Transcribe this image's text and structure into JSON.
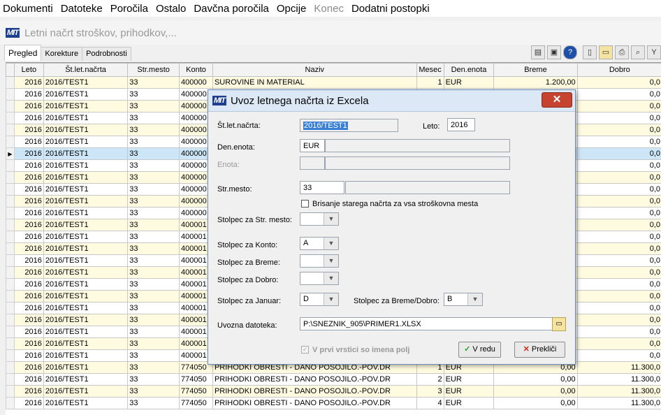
{
  "menu": [
    "Dokumenti",
    "Datoteke",
    "Poročila",
    "Ostalo",
    "Davčna poročila",
    "Opcije",
    "Konec",
    "Dodatni postopki"
  ],
  "app": {
    "logo": "MIT",
    "title": "Letni načrt stroškov, prihodkov,..."
  },
  "tabs": [
    "Pregled",
    "Korekture",
    "Podrobnosti"
  ],
  "toolbar_icons": [
    "book-icon",
    "window-icon",
    "help-icon",
    "new-icon",
    "open-icon",
    "print-icon",
    "search-icon",
    "filter-icon"
  ],
  "grid": {
    "columns": [
      "Leto",
      "Št.let.načrta",
      "Str.mesto",
      "Konto",
      "Naziv",
      "Mesec",
      "Den.enota",
      "Breme",
      "Dobro"
    ],
    "rows": [
      [
        "2016",
        "2016/TEST1",
        "33",
        "400000",
        "SUROVINE IN MATERIAL",
        "1",
        "EUR",
        "1.200,00",
        "0,0"
      ],
      [
        "2016",
        "2016/TEST1",
        "33",
        "400000",
        "",
        "",
        "",
        "",
        "0,0"
      ],
      [
        "2016",
        "2016/TEST1",
        "33",
        "400000",
        "",
        "",
        "",
        "",
        "0,0"
      ],
      [
        "2016",
        "2016/TEST1",
        "33",
        "400000",
        "",
        "",
        "",
        "",
        "0,0"
      ],
      [
        "2016",
        "2016/TEST1",
        "33",
        "400000",
        "",
        "",
        "",
        "",
        "0,0"
      ],
      [
        "2016",
        "2016/TEST1",
        "33",
        "400000",
        "",
        "",
        "",
        "",
        "0,0"
      ],
      [
        "2016",
        "2016/TEST1",
        "33",
        "400000",
        "",
        "",
        "",
        "",
        "0,0"
      ],
      [
        "2016",
        "2016/TEST1",
        "33",
        "400000",
        "",
        "",
        "",
        "",
        "0,0"
      ],
      [
        "2016",
        "2016/TEST1",
        "33",
        "400000",
        "",
        "",
        "",
        "",
        "0,0"
      ],
      [
        "2016",
        "2016/TEST1",
        "33",
        "400000",
        "",
        "",
        "",
        "",
        "0,0"
      ],
      [
        "2016",
        "2016/TEST1",
        "33",
        "400000",
        "",
        "",
        "",
        "",
        "0,0"
      ],
      [
        "2016",
        "2016/TEST1",
        "33",
        "400000",
        "",
        "",
        "",
        "",
        "0,0"
      ],
      [
        "2016",
        "2016/TEST1",
        "33",
        "400001",
        "",
        "",
        "",
        "",
        "0,0"
      ],
      [
        "2016",
        "2016/TEST1",
        "33",
        "400001",
        "",
        "",
        "",
        "",
        "0,0"
      ],
      [
        "2016",
        "2016/TEST1",
        "33",
        "400001",
        "",
        "",
        "",
        "",
        "0,0"
      ],
      [
        "2016",
        "2016/TEST1",
        "33",
        "400001",
        "",
        "",
        "",
        "",
        "0,0"
      ],
      [
        "2016",
        "2016/TEST1",
        "33",
        "400001",
        "",
        "",
        "",
        "",
        "0,0"
      ],
      [
        "2016",
        "2016/TEST1",
        "33",
        "400001",
        "",
        "",
        "",
        "",
        "0,0"
      ],
      [
        "2016",
        "2016/TEST1",
        "33",
        "400001",
        "",
        "",
        "",
        "",
        "0,0"
      ],
      [
        "2016",
        "2016/TEST1",
        "33",
        "400001",
        "",
        "",
        "",
        "",
        "0,0"
      ],
      [
        "2016",
        "2016/TEST1",
        "33",
        "400001",
        "",
        "",
        "",
        "",
        "0,0"
      ],
      [
        "2016",
        "2016/TEST1",
        "33",
        "400001",
        "",
        "",
        "",
        "",
        "0,0"
      ],
      [
        "2016",
        "2016/TEST1",
        "33",
        "400001",
        "",
        "",
        "",
        "",
        "0,0"
      ],
      [
        "2016",
        "2016/TEST1",
        "33",
        "400001",
        "",
        "",
        "",
        "",
        "0,0"
      ],
      [
        "2016",
        "2016/TEST1",
        "33",
        "774050",
        "PRIHODKI OBRESTI - DANO POSOJILO.-POV.DR",
        "1",
        "EUR",
        "0,00",
        "11.300,0"
      ],
      [
        "2016",
        "2016/TEST1",
        "33",
        "774050",
        "PRIHODKI OBRESTI - DANO POSOJILO.-POV.DR",
        "2",
        "EUR",
        "0,00",
        "11.300,0"
      ],
      [
        "2016",
        "2016/TEST1",
        "33",
        "774050",
        "PRIHODKI OBRESTI - DANO POSOJILO.-POV.DR",
        "3",
        "EUR",
        "0,00",
        "11.300,0"
      ],
      [
        "2016",
        "2016/TEST1",
        "33",
        "774050",
        "PRIHODKI OBRESTI - DANO POSOJILO.-POV.DR",
        "4",
        "EUR",
        "0,00",
        "11.300,0"
      ]
    ],
    "selected_row": 6
  },
  "dialog": {
    "logo": "MIT",
    "title": "Uvoz letnega načrta iz Excela",
    "close_label": "✕",
    "stlet_label": "Št.let.načrta:",
    "stlet_value": "2016/TEST1",
    "leto_label": "Leto:",
    "leto_value": "2016",
    "denenota_label": "Den.enota:",
    "denenota_value": "EUR",
    "enota_label": "Enota:",
    "strmesto_label": "Str.mesto:",
    "strmesto_value": "33",
    "brisanje_label": "Brisanje starega načrta za vsa stroškovna mesta",
    "stolpec_strmesto_label": "Stolpec za Str. mesto:",
    "stolpec_strmesto_value": "",
    "stolpec_konto_label": "Stolpec za Konto:",
    "stolpec_konto_value": "A",
    "stolpec_breme_label": "Stolpec za Breme:",
    "stolpec_breme_value": "",
    "stolpec_dobro_label": "Stolpec za Dobro:",
    "stolpec_dobro_value": "",
    "stolpec_januar_label": "Stolpec za Januar:",
    "stolpec_januar_value": "D",
    "stolpec_bremedobro_label": "Stolpec za Breme/Dobro:",
    "stolpec_bremedobro_value": "B",
    "uvozna_label": "Uvozna datoteka:",
    "uvozna_value": "P:\\SNEZNIK_905\\PRIMER1.XLSX",
    "prvi_vrstici_label": "V prvi vrstici so imena polj",
    "ok_label": "V redu",
    "cancel_label": "Prekliči"
  }
}
